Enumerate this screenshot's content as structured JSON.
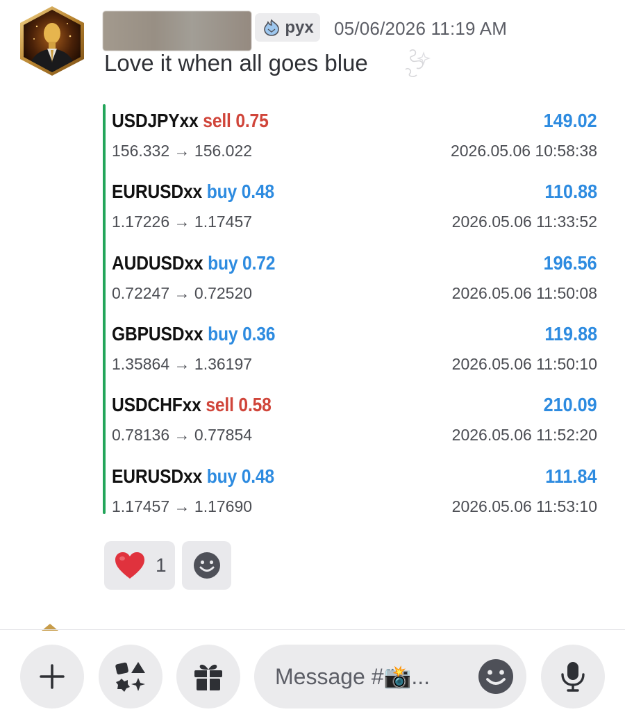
{
  "message": {
    "tag": "pyx",
    "timestamp": "05/06/2026 11:19 AM",
    "text": "Love it when all goes blue"
  },
  "trades": [
    {
      "symbol": "USDJPYxx",
      "side": "sell",
      "volume": "0.75",
      "profit": "149.02",
      "prices": "156.332 → 156.022",
      "time": "2026.05.06 10:58:38"
    },
    {
      "symbol": "EURUSDxx",
      "side": "buy",
      "volume": "0.48",
      "profit": "110.88",
      "prices": "1.17226 → 1.17457",
      "time": "2026.05.06 11:33:52"
    },
    {
      "symbol": "AUDUSDxx",
      "side": "buy",
      "volume": "0.72",
      "profit": "196.56",
      "prices": "0.72247 → 0.72520",
      "time": "2026.05.06 11:50:08"
    },
    {
      "symbol": "GBPUSDxx",
      "side": "buy",
      "volume": "0.36",
      "profit": "119.88",
      "prices": "1.35864 → 1.36197",
      "time": "2026.05.06 11:50:10"
    },
    {
      "symbol": "USDCHFxx",
      "side": "sell",
      "volume": "0.58",
      "profit": "210.09",
      "prices": "0.78136 → 0.77854",
      "time": "2026.05.06 11:52:20"
    },
    {
      "symbol": "EURUSDxx",
      "side": "buy",
      "volume": "0.48",
      "profit": "111.84",
      "prices": "1.17457 → 1.17690",
      "time": "2026.05.06 11:53:10"
    }
  ],
  "reaction": {
    "emoji": "heart-icon",
    "count": "1"
  },
  "composer": {
    "placeholder": "Message #📸..."
  },
  "colors": {
    "sell": "#d0453a",
    "buy": "#2d8be0",
    "embed_bar": "#23a55a"
  }
}
